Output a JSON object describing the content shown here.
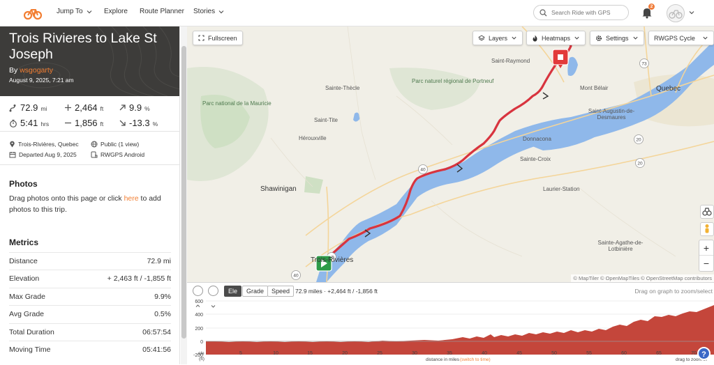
{
  "nav": {
    "jump_to": "Jump To",
    "explore": "Explore",
    "route_planner": "Route Planner",
    "stories": "Stories",
    "search_placeholder": "Search Ride with GPS",
    "notification_count": "2"
  },
  "trip": {
    "title": "Trois Rivieres to Lake St Joseph",
    "by_label": "By",
    "author": "wsgogarty",
    "date": "August 9, 2025, 7:21 am"
  },
  "stats": {
    "distance": "72.9",
    "distance_unit": "mi",
    "elev_gain": "2,464",
    "elev_gain_unit": "ft",
    "max_grade": "9.9",
    "max_grade_unit": "%",
    "moving_time": "5:41",
    "moving_time_unit": "hrs",
    "elev_loss": "1,856",
    "elev_loss_unit": "ft",
    "min_grade": "-13.3",
    "min_grade_unit": "%"
  },
  "info": {
    "location": "Trois-Rivières, Quebec",
    "visibility": "Public (1 view)",
    "departed": "Departed Aug 9, 2025",
    "device": "RWGPS Android"
  },
  "photos": {
    "title": "Photos",
    "text_before": "Drag photos onto this page or click ",
    "link": "here",
    "text_after": " to add photos to this trip."
  },
  "metrics": {
    "title": "Metrics",
    "rows": [
      {
        "label": "Distance",
        "value": "72.9 mi"
      },
      {
        "label": "Elevation",
        "value": "+ 2,463 ft / -1,855 ft"
      },
      {
        "label": "Max Grade",
        "value": "9.9%"
      },
      {
        "label": "Avg Grade",
        "value": "0.5%"
      },
      {
        "label": "Total Duration",
        "value": "06:57:54"
      },
      {
        "label": "Moving Time",
        "value": "05:41:56"
      }
    ]
  },
  "map": {
    "fullscreen": "Fullscreen",
    "layers": "Layers",
    "heatmaps": "Heatmaps",
    "settings": "Settings",
    "basemap": "RWGPS Cycle",
    "attribution": "© MapTiler © OpenMapTiles © OpenStreetMap contributors",
    "labels": {
      "saint_raymond": "Saint-Raymond",
      "sainte_thecle": "Sainte-Thècle",
      "parc_portneuf": "Parc naturel régional de Portneuf",
      "parc_mauricie": "Parc national de la Mauricie",
      "saint_tite": "Saint-Tite",
      "herouxville": "Hérouxville",
      "mont_belair": "Mont Bélair",
      "quebec": "Quebec",
      "saint_augustin": "Saint-Augustin-de-Desmaures",
      "donnacona": "Donnacona",
      "sainte_croix": "Sainte-Croix",
      "laurier_station": "Laurier-Station",
      "shawinigan": "Shawinigan",
      "sainte_agathe": "Sainte-Agathe-de-Lotbinière",
      "trois_rivieres": "Trois-Rivières",
      "hwy_40": "40",
      "hwy_40b": "40",
      "hwy_55": "55",
      "hwy_73": "73",
      "hwy_20": "20",
      "hwy_20b": "20"
    }
  },
  "elevation": {
    "tab_ele": "Ele",
    "tab_grade": "Grade",
    "tab_speed": "Speed",
    "summary": "72.9 miles · +2,464 ft / -1,856 ft",
    "hint": "Drag on graph to zoom/select",
    "y_ticks": [
      "600",
      "400",
      "200",
      "0",
      "-200"
    ],
    "x_ticks": [
      "5",
      "10",
      "15",
      "20",
      "25",
      "30",
      "35",
      "40",
      "45",
      "50",
      "55",
      "60",
      "65",
      "70"
    ],
    "y_unit_top": "ele",
    "y_unit_bottom": "(ft)",
    "x_label": "distance in miles",
    "x_switch": "(switch to time)",
    "zoom_hint": "drag to zoom in",
    "help": "?"
  },
  "colors": {
    "accent": "#f27e32",
    "route": "#d8343f",
    "water": "#8fb8ea",
    "profile": "#c4463b"
  }
}
